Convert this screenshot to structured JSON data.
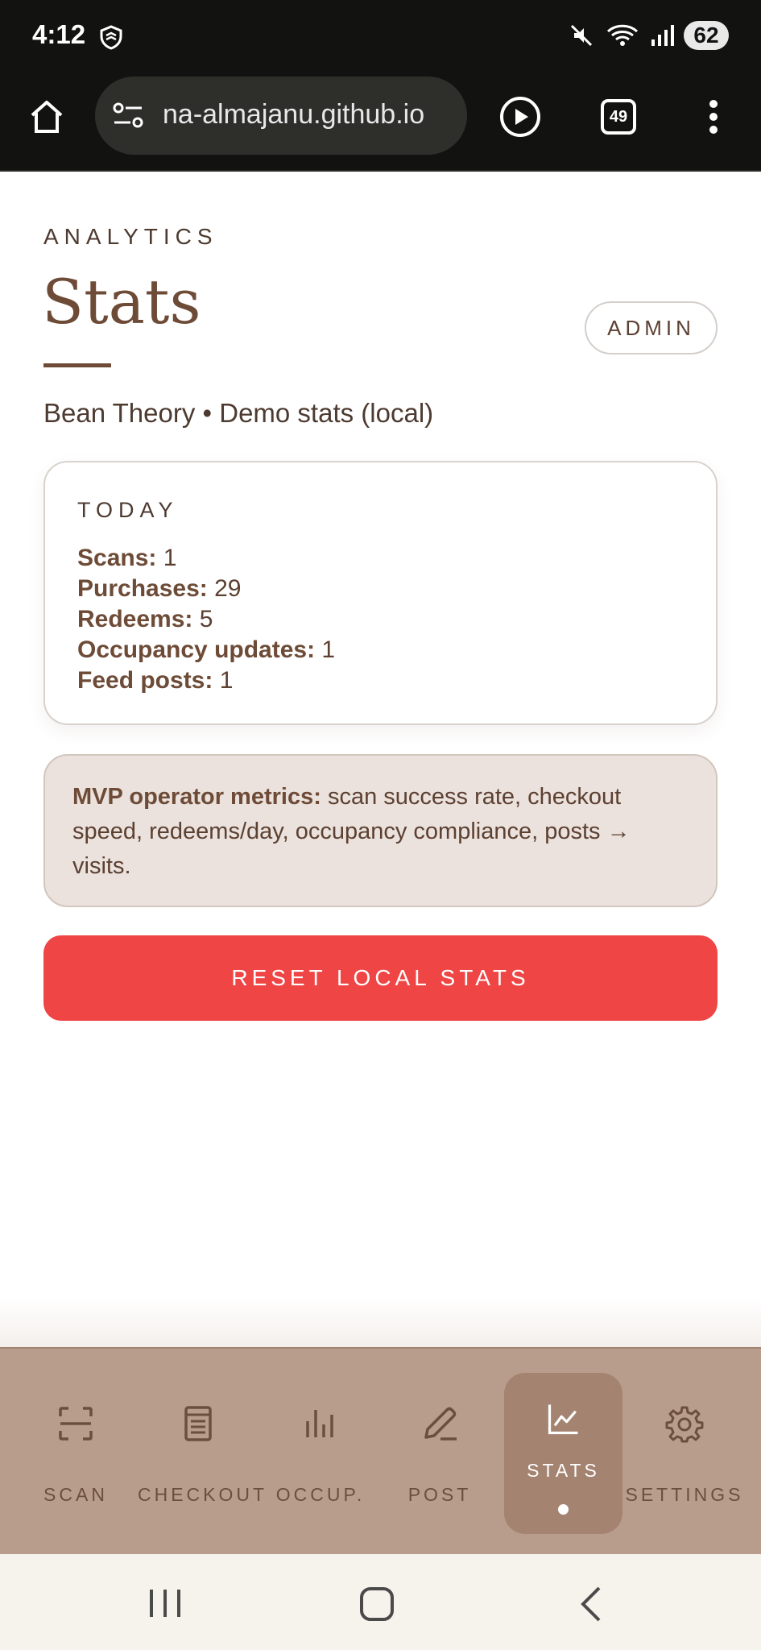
{
  "status_bar": {
    "time": "4:12",
    "battery": "62",
    "icons": [
      "app-shield-icon",
      "mute-icon",
      "wifi-icon",
      "signal-icon"
    ]
  },
  "browser": {
    "url": "na-almajanu.github.io",
    "tab_count": "49",
    "icons": [
      "home-icon",
      "site-settings-icon",
      "play-icon",
      "tabs-icon",
      "more-icon"
    ]
  },
  "page": {
    "eyebrow": "ANALYTICS",
    "title": "Stats",
    "badge": "ADMIN",
    "subtitle": "Bean Theory • Demo stats (local)"
  },
  "today": {
    "label": "TODAY",
    "stats": [
      {
        "label": "Scans:",
        "value": "1"
      },
      {
        "label": "Purchases:",
        "value": "29"
      },
      {
        "label": "Redeems:",
        "value": "5"
      },
      {
        "label": "Occupancy updates:",
        "value": "1"
      },
      {
        "label": "Feed posts:",
        "value": "1"
      }
    ]
  },
  "metrics_note": {
    "bold": "MVP operator metrics:",
    "text": " scan success rate, checkout speed, redeems/day, occupancy compliance, posts → visits."
  },
  "reset_button": "RESET LOCAL STATS",
  "bottom_nav": {
    "items": [
      {
        "label": "SCAN",
        "icon": "scan-icon"
      },
      {
        "label": "CHECKOUT",
        "icon": "receipt-icon"
      },
      {
        "label": "OCCUP.",
        "icon": "bar-chart-icon"
      },
      {
        "label": "POST",
        "icon": "pencil-icon"
      },
      {
        "label": "STATS",
        "icon": "line-chart-icon",
        "active": true
      },
      {
        "label": "SETTINGS",
        "icon": "gear-icon"
      }
    ]
  },
  "colors": {
    "accent_brown": "#6d4b37",
    "nav_bg": "#b99d8c",
    "nav_active_bg": "#a48371",
    "danger": "#ef4545",
    "note_bg": "#ebe2dd"
  }
}
